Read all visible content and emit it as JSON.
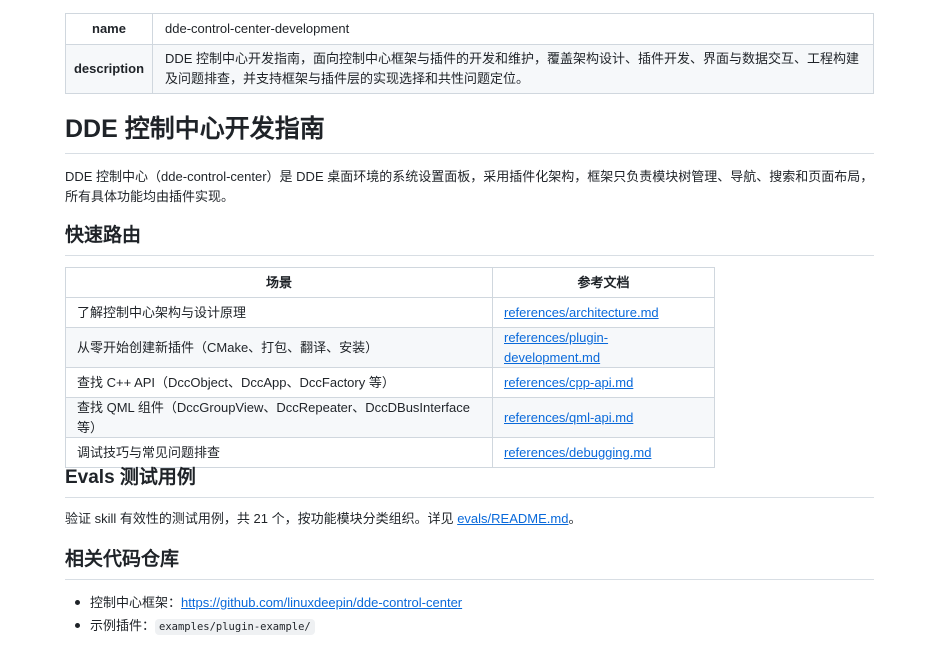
{
  "frontmatter": {
    "name_key": "name",
    "name_value": "dde-control-center-development",
    "description_key": "description",
    "description_value": "DDE 控制中心开发指南，面向控制中心框架与插件的开发和维护，覆盖架构设计、插件开发、界面与数据交互、工程构建及问题排查，并支持框架与插件层的实现选择和共性问题定位。"
  },
  "title": "DDE 控制中心开发指南",
  "intro": "DDE 控制中心（dde-control-center）是 DDE 桌面环境的系统设置面板，采用插件化架构，框架只负责模块树管理、导航、搜索和页面布局，所有具体功能均由插件实现。",
  "quick_route": {
    "heading": "快速路由",
    "headers": {
      "scene": "场景",
      "doc": "参考文档"
    },
    "rows": [
      {
        "scene": "了解控制中心架构与设计原理",
        "doc": "references/architecture.md"
      },
      {
        "scene": "从零开始创建新插件（CMake、打包、翻译、安装）",
        "doc": "references/plugin-development.md"
      },
      {
        "scene": "查找 C++ API（DccObject、DccApp、DccFactory 等）",
        "doc": "references/cpp-api.md"
      },
      {
        "scene": "查找 QML 组件（DccGroupView、DccRepeater、DccDBusInterface 等）",
        "doc": "references/qml-api.md"
      },
      {
        "scene": "调试技巧与常见问题排查",
        "doc": "references/debugging.md"
      }
    ]
  },
  "evals": {
    "heading": "Evals 测试用例",
    "text_before": "验证 skill 有效性的测试用例，共 21 个，按功能模块分类组织。详见 ",
    "link": "evals/README.md",
    "text_after": "。"
  },
  "repos": {
    "heading": "相关代码仓库",
    "framework_label": "控制中心框架：",
    "framework_link": "https://github.com/linuxdeepin/dde-control-center",
    "example_label": "示例插件：",
    "example_code": "examples/plugin-example/"
  }
}
